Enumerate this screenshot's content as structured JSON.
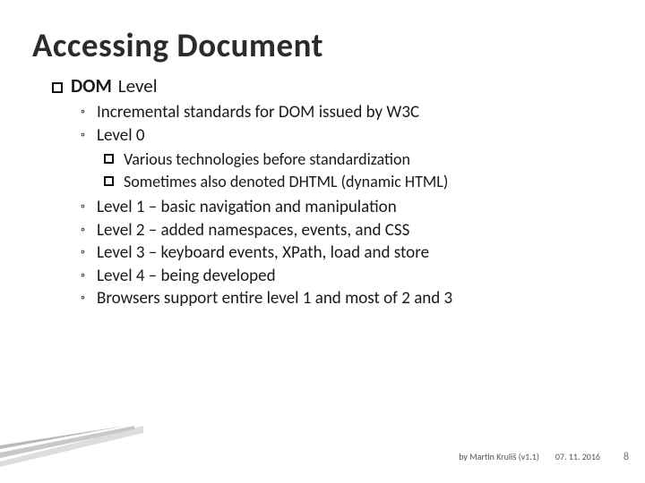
{
  "title": "Accessing Document",
  "top": {
    "prefix": "DOM",
    "suffix": "Level"
  },
  "bullets_a": [
    "Incremental standards for DOM issued by W3C",
    "Level 0"
  ],
  "subbullets": [
    "Various technologies before standardization",
    "Sometimes also denoted DHTML (dynamic HTML)"
  ],
  "bullets_b": [
    "Level 1 – basic navigation and manipulation",
    "Level 2 – added namespaces, events, and CSS",
    "Level 3 – keyboard events, XPath, load and store",
    "Level 4 – being developed",
    "Browsers support entire level 1 and most of 2 and 3"
  ],
  "footer": {
    "author": "by Martin Kruliš (v1.1)",
    "date": "07. 11. 2016",
    "page": "8"
  }
}
